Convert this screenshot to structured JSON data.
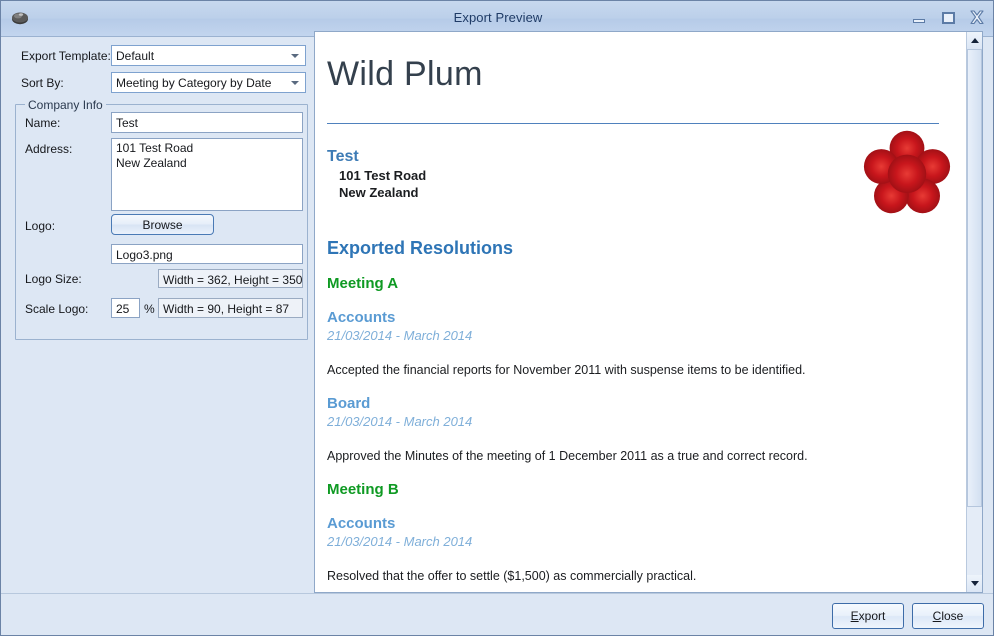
{
  "window": {
    "title": "Export Preview",
    "app_icon": "app-icon",
    "minimize_label": "Minimize",
    "maximize_label": "Maximize",
    "close_label": "Close"
  },
  "settings": {
    "export_template": {
      "label": "Export Template:",
      "value": "Default"
    },
    "sort_by": {
      "label": "Sort By:",
      "value": "Meeting by Category by Date"
    },
    "company_info": {
      "legend": "Company Info",
      "name": {
        "label": "Name:",
        "value": "Test"
      },
      "address": {
        "label": "Address:",
        "value": "101 Test Road\nNew Zealand"
      },
      "logo": {
        "label": "Logo:",
        "browse_label": "Browse",
        "filename": "Logo3.png"
      },
      "logo_size": {
        "label": "Logo Size:",
        "value": "Width = 362, Height = 350"
      },
      "scale_logo": {
        "label": "Scale Logo:",
        "value": "25",
        "unit": "%",
        "result": "Width = 90, Height = 87"
      }
    }
  },
  "preview": {
    "doc_title": "Wild Plum",
    "company_name": "Test",
    "address_line1": "101 Test Road",
    "address_line2": "New Zealand",
    "logo_alt": "plum-blossom-logo",
    "section_heading": "Exported Resolutions",
    "entries": [
      {
        "meeting": "Meeting A",
        "category": "Accounts",
        "date": "21/03/2014 - March 2014",
        "text": "Accepted the financial reports for November 2011 with suspense items to be identified."
      },
      {
        "meeting": "",
        "category": "Board",
        "date": "21/03/2014 - March 2014",
        "text": "Approved the Minutes of the meeting of 1 December 2011 as a true and correct record."
      },
      {
        "meeting": "Meeting B",
        "category": "Accounts",
        "date": "21/03/2014 - March 2014",
        "text": "Resolved that the offer to settle ($1,500) as commercially practical."
      }
    ]
  },
  "footer": {
    "export": {
      "accel": "E",
      "rest": "xport"
    },
    "close": {
      "accel": "C",
      "rest": "lose"
    }
  },
  "colors": {
    "dialog_bg": "#dde7f4",
    "title_accent": "#4f81bd",
    "heading_blue": "#2e75b6",
    "category_blue": "#5a9bd3",
    "meeting_green": "#0f9a23",
    "logo_red": "#c1121c"
  }
}
